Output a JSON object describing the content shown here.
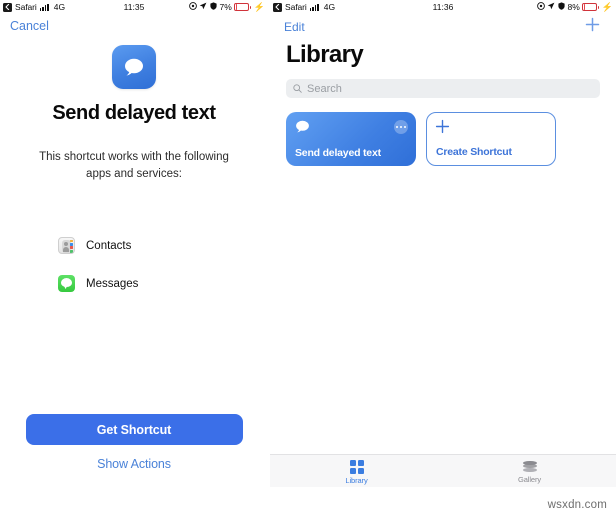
{
  "left_screen": {
    "status_bar": {
      "back_app": "Safari",
      "network": "4G",
      "time": "11:35",
      "battery_percent": "7%",
      "battery_level": 7,
      "icons": [
        "back-chevron-icon",
        "signal-bars-icon",
        "location-arrow-icon",
        "orientation-lock-icon",
        "battery-icon",
        "charging-bolt-icon"
      ]
    },
    "nav": {
      "cancel_label": "Cancel"
    },
    "hero": {
      "icon": "message-bubble-icon",
      "title": "Send delayed text",
      "description": "This shortcut works with the following apps and services:"
    },
    "apps": [
      {
        "name": "Contacts",
        "icon": "contacts-app-icon"
      },
      {
        "name": "Messages",
        "icon": "messages-app-icon"
      }
    ],
    "actions": {
      "primary_label": "Get Shortcut",
      "secondary_label": "Show Actions"
    }
  },
  "right_screen": {
    "status_bar": {
      "back_app": "Safari",
      "network": "4G",
      "time": "11:36",
      "battery_percent": "8%",
      "battery_level": 8,
      "icons": [
        "back-chevron-icon",
        "signal-bars-icon",
        "location-arrow-icon",
        "orientation-lock-icon",
        "battery-icon",
        "charging-bolt-icon"
      ]
    },
    "nav": {
      "edit_label": "Edit",
      "add_icon": "plus-icon"
    },
    "page_title": "Library",
    "search": {
      "placeholder": "Search",
      "icon": "search-icon"
    },
    "cards": [
      {
        "label": "Send delayed text",
        "type": "shortcut",
        "icon": "message-bubble-icon",
        "menu_icon": "ellipsis-icon"
      },
      {
        "label": "Create Shortcut",
        "type": "create",
        "icon": "plus-icon"
      }
    ],
    "tabs": [
      {
        "label": "Library",
        "icon": "grid-icon",
        "active": true
      },
      {
        "label": "Gallery",
        "icon": "layers-icon",
        "active": false
      }
    ]
  },
  "watermark": "wsxdn.com",
  "colors": {
    "accent_blue": "#3b6fe8",
    "link_blue": "#4a82d8",
    "card_blue": "#3f7fe2",
    "battery_red": "#e8454d",
    "messages_green": "#36c93f",
    "tab_inactive": "#8b8b90"
  }
}
